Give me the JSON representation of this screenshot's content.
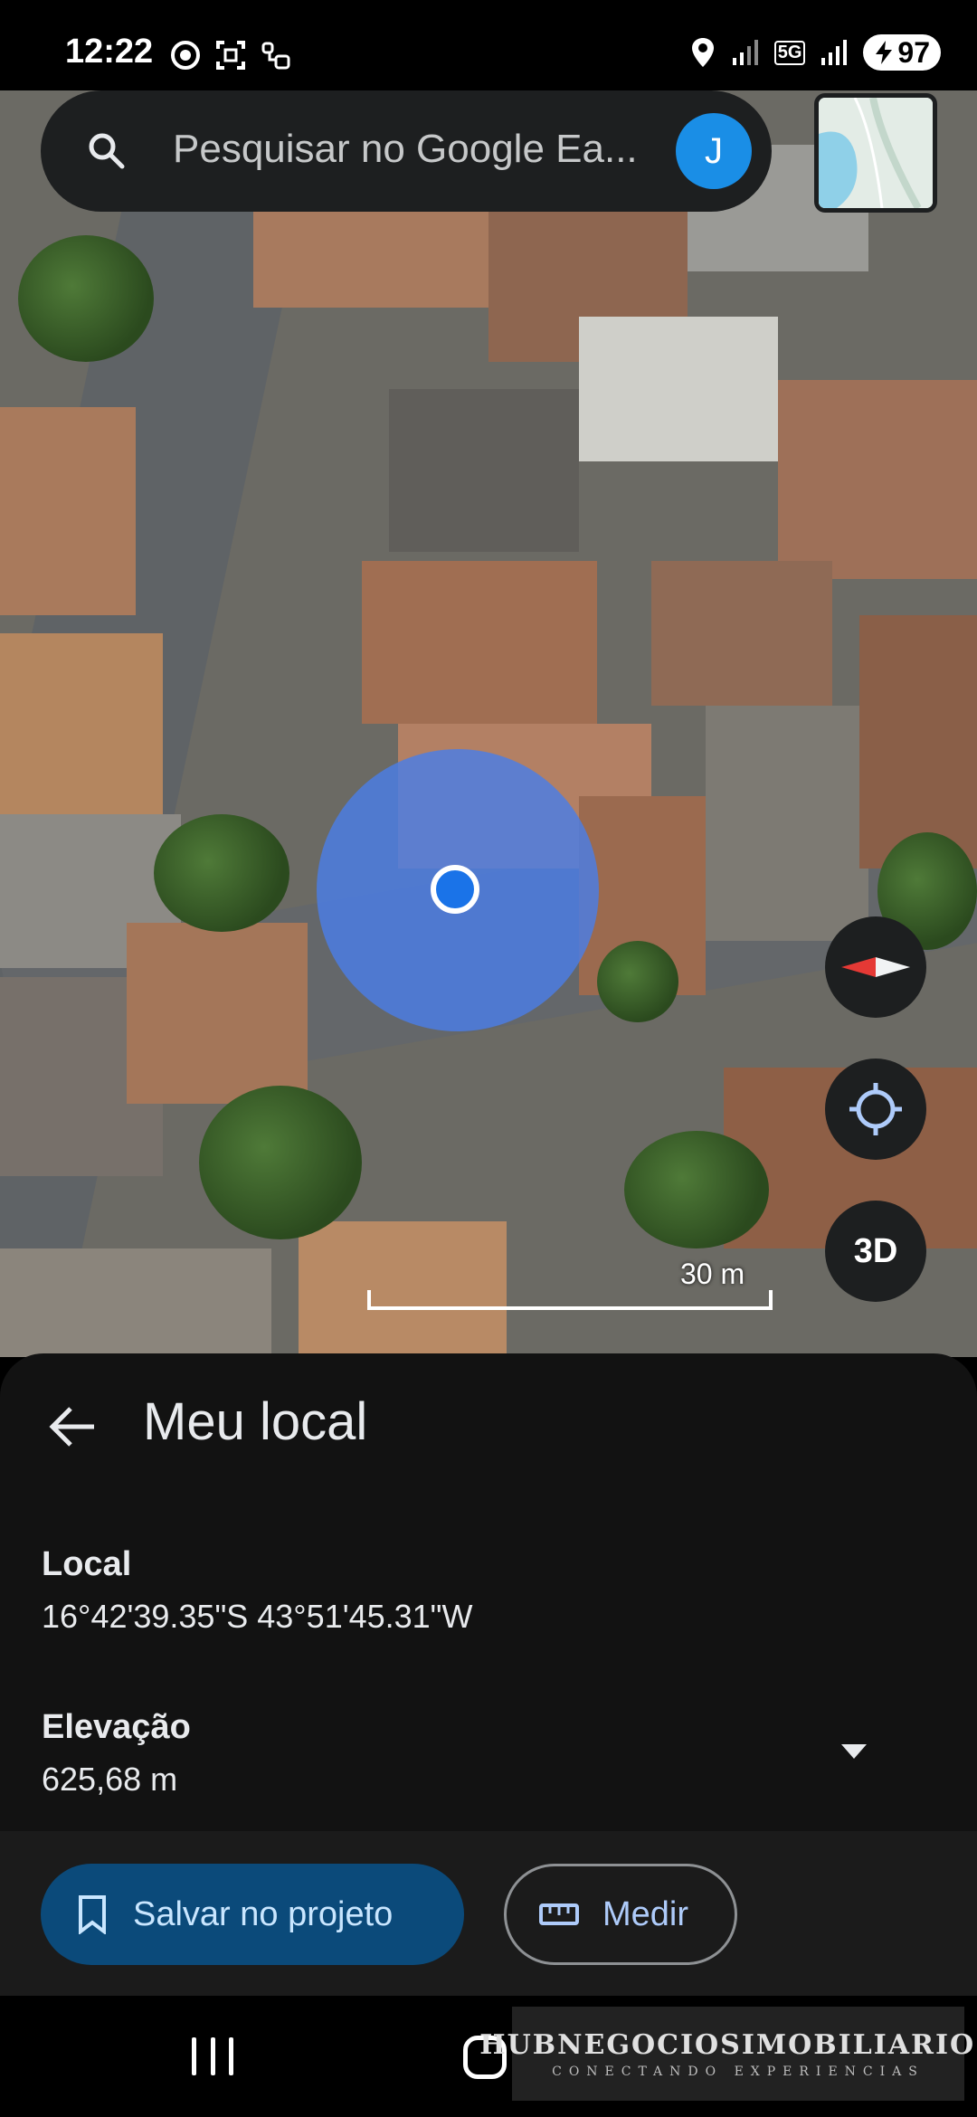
{
  "status_bar": {
    "time": "12:22",
    "network": "5G",
    "battery": "97"
  },
  "search": {
    "placeholder": "Pesquisar no Google Ea...",
    "avatar_initial": "J"
  },
  "map": {
    "scale_label": "30 m",
    "button_3d": "3D"
  },
  "sheet": {
    "title": "Meu local",
    "location_label": "Local",
    "location_value": "16°42'39.35\"S 43°51'45.31\"W",
    "elevation_label": "Elevação",
    "elevation_value": "625,68 m"
  },
  "actions": {
    "save_label": "Salvar no projeto",
    "measure_label": "Medir"
  },
  "watermark": {
    "main": "HUBNEGOCIOSIMOBILIARIOS",
    "sub": "CONECTANDO EXPERIENCIAS"
  },
  "colors": {
    "accent_blue": "#1a73e8",
    "save_button_bg": "#0b4a7a",
    "sheet_bg": "#121212"
  }
}
